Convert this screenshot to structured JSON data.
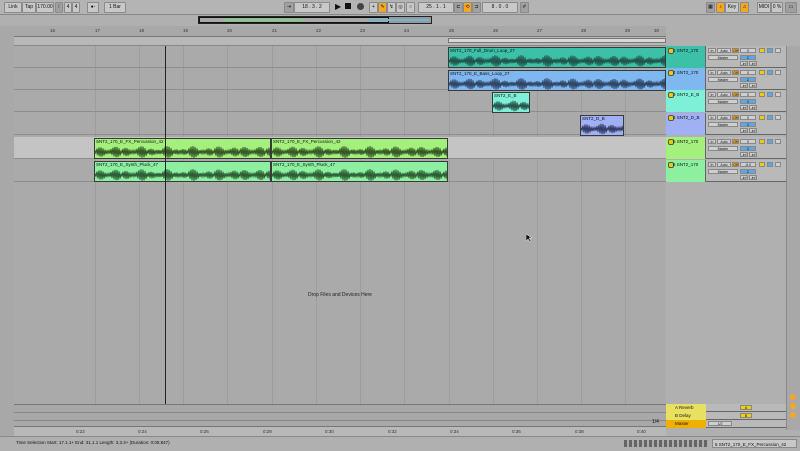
{
  "topbar": {
    "link": "Link",
    "tap": "Tap",
    "tempo": "170.00",
    "sig_num": "4",
    "sig_den": "4",
    "quant": "1 Bar",
    "position": "18 .   3 .   2",
    "loop_start": "25 .   1 .   1",
    "loop_len": "8 .   0 .   0",
    "key": "Key",
    "midi": "MIDI",
    "cpu": "0 %"
  },
  "ruler": {
    "top_ticks": [
      "16",
      "17",
      "18",
      "19",
      "20",
      "21",
      "22",
      "23",
      "24",
      "25",
      "26",
      "27",
      "28",
      "29",
      "30"
    ],
    "bottom_ticks": [
      "0:22",
      "0:24",
      "0:26",
      "0:28",
      "0:30",
      "0:32",
      "0:34",
      "0:36",
      "0:38",
      "0:40"
    ]
  },
  "tracks": [
    {
      "name": "1 SNT2_170",
      "color": "#3cc0a8",
      "volume": "0",
      "pan": "C",
      "send_a": "-inf",
      "send_b": "-inf",
      "output": "Master"
    },
    {
      "name": "2 SNT2_170",
      "color": "#7fb7f0",
      "volume": "0",
      "pan": "C",
      "send_a": "-inf",
      "send_b": "-inf",
      "output": "Master"
    },
    {
      "name": "3 SNT2_E_B",
      "color": "#7ff0d8",
      "volume": "0",
      "pan": "C",
      "send_a": "-inf",
      "send_b": "-inf",
      "output": "Master"
    },
    {
      "name": "4 SNT2_D_B",
      "color": "#9fb0f5",
      "volume": "0",
      "pan": "C",
      "send_a": "-inf",
      "send_b": "-inf",
      "output": "Master"
    },
    {
      "name": "5 SNT2_170",
      "color": "#a4f07c",
      "volume": "0",
      "pan": "C",
      "send_a": "-inf",
      "send_b": "-inf",
      "output": "Master"
    },
    {
      "name": "6 SNT2_170",
      "color": "#8cf0a0",
      "volume": "-5.0",
      "pan": "C",
      "send_a": "-inf",
      "send_b": "-inf",
      "output": "Master"
    }
  ],
  "track_io": {
    "in": "In",
    "auto": "Auto",
    "off": "Off"
  },
  "clips": [
    {
      "title": "SNT2_170_Full_Drum_Loop_27",
      "color": "#3cc0a8",
      "wave": "#1a3a34"
    },
    {
      "title": "SNT2_170_E_Bass_Loop_27",
      "color": "#7fb7f0",
      "wave": "#1c2a44"
    },
    {
      "title": "SNT2_E_B",
      "color": "#7ff0d8",
      "wave": "#14302a"
    },
    {
      "title": "SNT2_D_B",
      "color": "#9fb0f5",
      "wave": "#1c2244"
    },
    {
      "title": "SNT2_170_E_FX_Percussion_42",
      "color": "#a4f07c",
      "wave": "#1a3414"
    },
    {
      "title": "SNT2_170_E_FX_Percussion_42",
      "color": "#a4f07c",
      "wave": "#1a3414"
    },
    {
      "title": "SNT2_170_E_Synth_Pluck_47",
      "color": "#8cf0a0",
      "wave": "#163a1c"
    },
    {
      "title": "SNT2_170_E_Synth_Pluck_47",
      "color": "#8cf0a0",
      "wave": "#163a1c"
    }
  ],
  "drop_text": "Drop Files and Devices Here",
  "returns": [
    {
      "name": "A Reverb",
      "color": "#e8e060",
      "letter": "A"
    },
    {
      "name": "B Delay",
      "color": "#e8e060",
      "letter": "B"
    },
    {
      "name": "Master",
      "color": "#f0b000",
      "letter": "Master"
    }
  ],
  "master_output": "1/2",
  "status": {
    "text": "Time Selection   Start: 17.1.1+   End: 31.1.1   Length: 3.3.3+   (Duration: 0:05:847)",
    "selected": "5 SNT2_170_E_FX_Percussion_42"
  },
  "page_fraction": "1/4"
}
